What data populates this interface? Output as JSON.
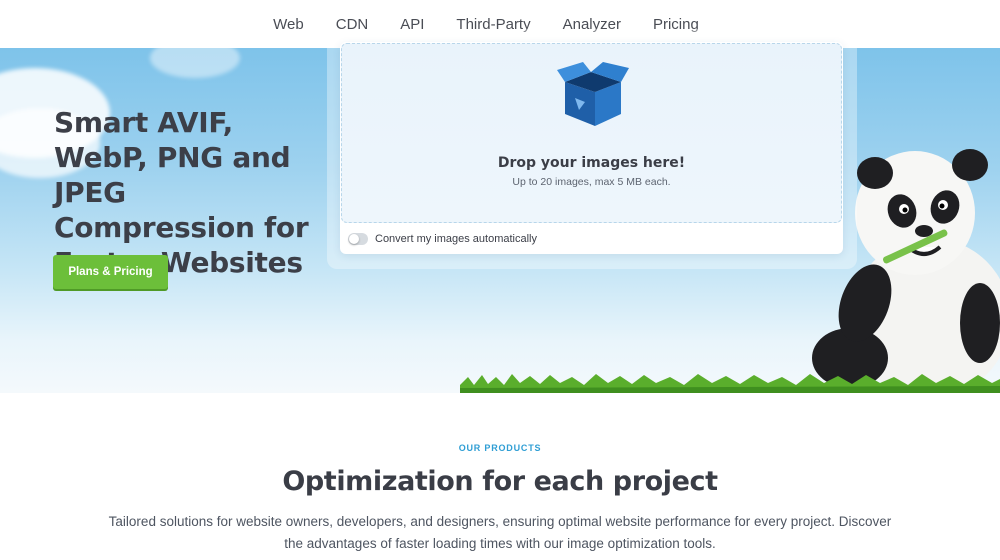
{
  "nav": {
    "items": [
      "Web",
      "CDN",
      "API",
      "Third-Party",
      "Analyzer",
      "Pricing"
    ]
  },
  "hero": {
    "headline": "Smart AVIF, WebP, PNG and JPEG Compression for Faster Websites",
    "cta_label": "Plans & Pricing",
    "dropzone": {
      "title": "Drop your images here!",
      "subtitle": "Up to 20 images, max 5 MB each.",
      "icon": "box-icon"
    },
    "toggle": {
      "label": "Convert my images automatically",
      "enabled": false
    },
    "mascot": "panda-illustration"
  },
  "products": {
    "tag": "OUR PRODUCTS",
    "title": "Optimization for each project",
    "description": "Tailored solutions for website owners, developers, and designers, ensuring optimal website performance for every project. Discover the advantages of faster loading times with our image optimization tools."
  },
  "colors": {
    "accent_green": "#6cbf3a",
    "accent_blue": "#2f9ed4",
    "sky_top": "#7ec3ea",
    "text_dark": "#3b3e47"
  }
}
